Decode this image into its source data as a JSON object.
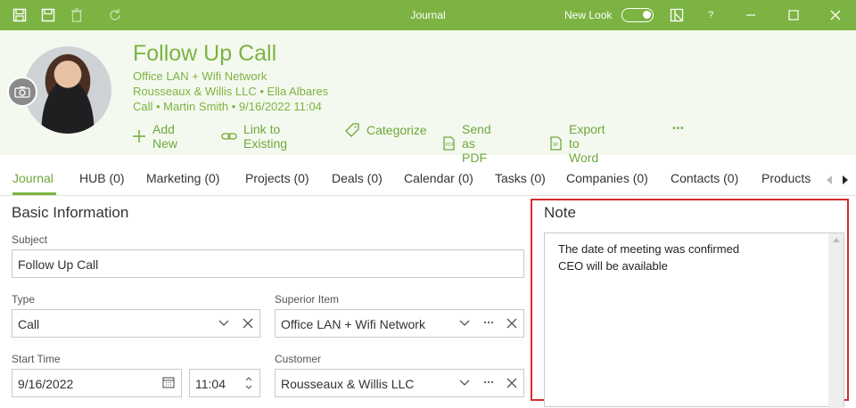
{
  "titlebar": {
    "title": "Journal",
    "new_look_label": "New Look",
    "help_label": "?"
  },
  "header": {
    "title": "Follow Up Call",
    "line1": "Office LAN + Wifi Network",
    "line2": "Rousseaux & Willis LLC • Ella Albares",
    "line3": "Call • Martin Smith • 9/16/2022 11:04",
    "actions": {
      "add_new": "Add New",
      "link_existing": "Link to Existing",
      "categorize": "Categorize",
      "send_pdf": "Send as PDF",
      "export_word": "Export to Word",
      "more": "•••"
    }
  },
  "tabs": [
    {
      "label": "Journal"
    },
    {
      "label": "HUB (0)"
    },
    {
      "label": "Marketing (0)"
    },
    {
      "label": "Projects (0)"
    },
    {
      "label": "Deals (0)"
    },
    {
      "label": "Calendar (0)"
    },
    {
      "label": "Tasks (0)"
    },
    {
      "label": "Companies (0)"
    },
    {
      "label": "Contacts (0)"
    },
    {
      "label": "Products ("
    }
  ],
  "basic": {
    "title": "Basic Information",
    "subject_label": "Subject",
    "subject_value": "Follow Up Call",
    "type_label": "Type",
    "type_value": "Call",
    "superior_label": "Superior Item",
    "superior_value": "Office LAN + Wifi Network",
    "start_label": "Start Time",
    "start_date": "9/16/2022",
    "start_time": "11:04",
    "customer_label": "Customer",
    "customer_value": "Rousseaux & Willis LLC"
  },
  "note": {
    "title": "Note",
    "line1": "The date of meeting was confirmed",
    "line2": "CEO will be available"
  },
  "colors": {
    "accent": "#7cb342",
    "highlight_frame": "#d32f2f"
  }
}
